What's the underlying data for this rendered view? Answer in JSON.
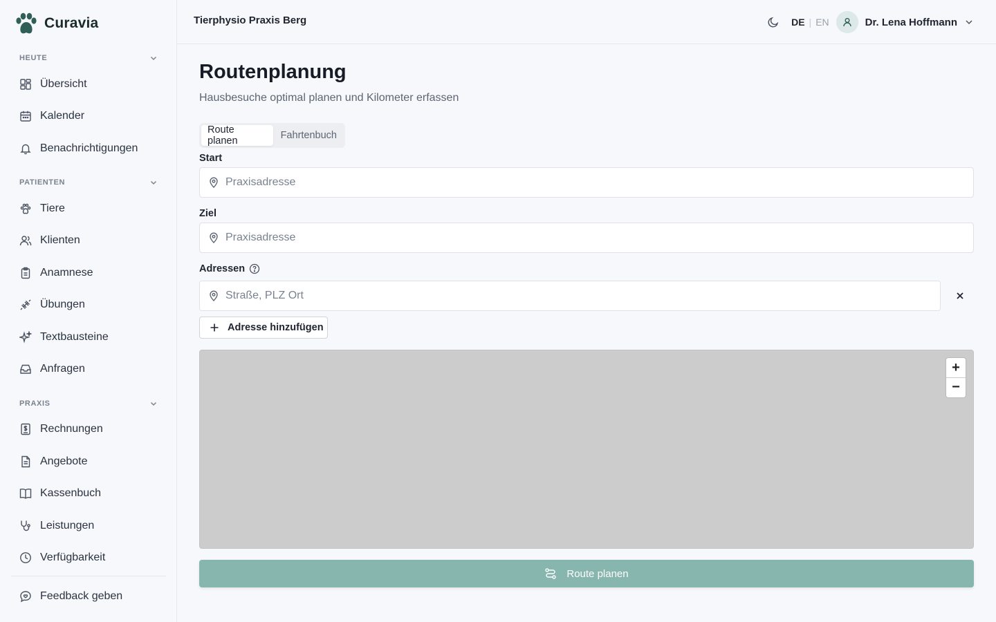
{
  "brand": {
    "name": "Curavia",
    "accent": "#2f5f57"
  },
  "sidebar": {
    "sections": [
      {
        "label": "HEUTE"
      },
      {
        "label": "PATIENTEN"
      },
      {
        "label": "PRAXIS"
      }
    ],
    "items": [
      {
        "label": "Übersicht",
        "icon": "dashboard-icon"
      },
      {
        "label": "Kalender",
        "icon": "calendar-icon"
      },
      {
        "label": "Benachrichtigungen",
        "icon": "bell-icon"
      },
      {
        "label": "Tiere",
        "icon": "paw-icon"
      },
      {
        "label": "Klienten",
        "icon": "users-icon"
      },
      {
        "label": "Anamnese",
        "icon": "clipboard-icon"
      },
      {
        "label": "Übungen",
        "icon": "dumbbell-icon"
      },
      {
        "label": "Textbausteine",
        "icon": "sparkles-icon"
      },
      {
        "label": "Anfragen",
        "icon": "inbox-icon"
      },
      {
        "label": "Rechnungen",
        "icon": "invoice-icon"
      },
      {
        "label": "Angebote",
        "icon": "document-icon"
      },
      {
        "label": "Kassenbuch",
        "icon": "book-icon"
      },
      {
        "label": "Leistungen",
        "icon": "stethoscope-icon"
      },
      {
        "label": "Verfügbarkeit",
        "icon": "clock-icon"
      }
    ],
    "feedback": {
      "label": "Feedback geben",
      "icon": "feedback-icon"
    }
  },
  "topbar": {
    "practice_name": "Tierphysio Praxis Berg",
    "lang_active": "DE",
    "lang_separator": "|",
    "lang_other": "EN",
    "user_name": "Dr. Lena Hoffmann"
  },
  "main": {
    "title": "Routenplanung",
    "subtitle": "Hausbesuche optimal planen und Kilometer erfassen",
    "tabs": [
      {
        "label": "Route planen",
        "active": true
      },
      {
        "label": "Fahrtenbuch",
        "active": false
      }
    ],
    "start": {
      "label": "Start",
      "placeholder": "Praxisadresse",
      "value": ""
    },
    "ziel": {
      "label": "Ziel",
      "placeholder": "Praxisadresse",
      "value": ""
    },
    "addresses": {
      "label": "Adressen",
      "placeholder": "Straße, PLZ Ort",
      "value": ""
    },
    "add_address_label": "Adresse hinzufügen",
    "map": {
      "zoom_in": "+",
      "zoom_out": "−"
    },
    "plan_button_label": "Route planen",
    "plan_button_color": "#86b6ad"
  }
}
